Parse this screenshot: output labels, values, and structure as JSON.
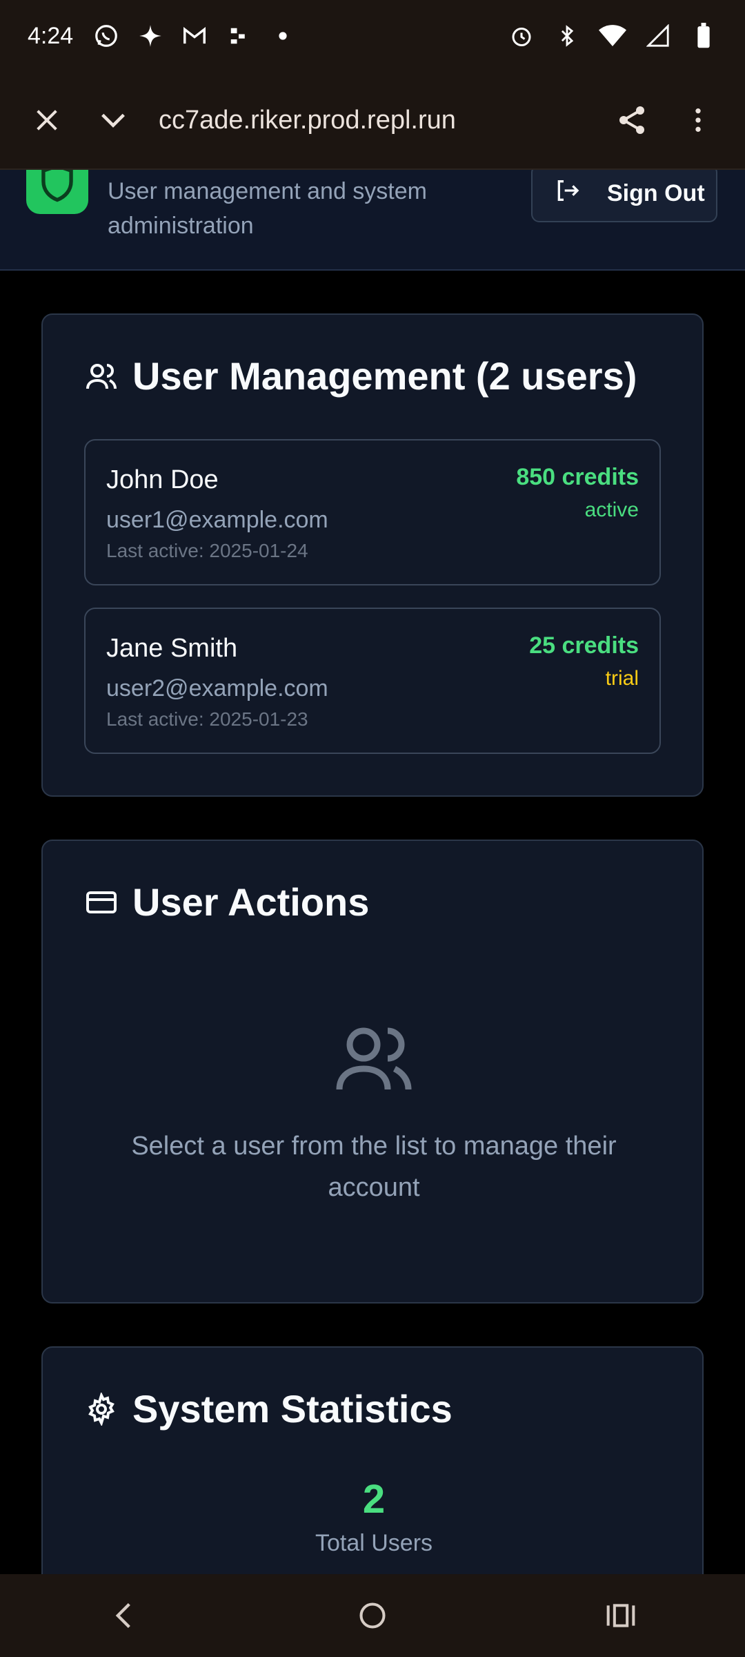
{
  "status_bar": {
    "time": "4:24",
    "left_icons": [
      "whatsapp-icon",
      "sparkle-icon",
      "gmail-icon",
      "app-icon",
      "dot-icon"
    ],
    "right_icons": [
      "alarm-icon",
      "bluetooth-icon",
      "wifi-icon",
      "signal-icon",
      "battery-icon"
    ]
  },
  "browser": {
    "url": "cc7ade.riker.prod.repl.run"
  },
  "header": {
    "subtitle": "User management and system administration",
    "signout_label": "Sign Out",
    "accent": "#22c55e"
  },
  "user_management": {
    "title": "User Management (2 users)",
    "users": [
      {
        "name": "John Doe",
        "email": "user1@example.com",
        "last_active": "Last active: 2025-01-24",
        "credits": "850 credits",
        "status": "active"
      },
      {
        "name": "Jane Smith",
        "email": "user2@example.com",
        "last_active": "Last active: 2025-01-23",
        "credits": "25 credits",
        "status": "trial"
      }
    ]
  },
  "user_actions": {
    "title": "User Actions",
    "empty_text": "Select a user from the list to manage their account"
  },
  "system_stats": {
    "title": "System Statistics",
    "total_users_value": "2",
    "total_users_label": "Total Users"
  },
  "colors": {
    "active": "#4ade80",
    "trial": "#facc15",
    "card_bg": "#111827"
  }
}
